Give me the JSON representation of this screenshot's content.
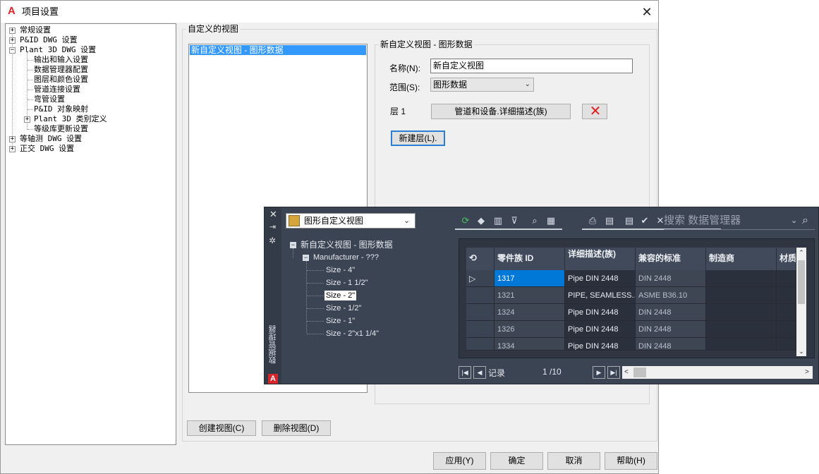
{
  "dialog": {
    "title": "项目设置",
    "app_logo": "A",
    "close_glyph": "✕"
  },
  "left_tree": [
    {
      "label": "常规设置",
      "expander": "+"
    },
    {
      "label": "P&ID DWG 设置",
      "expander": "+"
    },
    {
      "label": "Plant 3D DWG 设置",
      "expander": "−"
    },
    {
      "label": "输出和输入设置"
    },
    {
      "label": "数据管理器配置"
    },
    {
      "label": "图层和颜色设置"
    },
    {
      "label": "管道连接设置"
    },
    {
      "label": "弯管设置"
    },
    {
      "label": "P&ID 对象映射"
    },
    {
      "label": "Plant 3D 类别定义",
      "expander": "+"
    },
    {
      "label": "等级库更新设置"
    },
    {
      "label": "等轴测 DWG 设置",
      "expander": "+"
    },
    {
      "label": "正交 DWG 设置",
      "expander": "+"
    }
  ],
  "custom_views": {
    "legend": "自定义的视图",
    "items": [
      "新自定义视图 - 图形数据"
    ],
    "detail_legend": "新自定义视图 - 图形数据",
    "name_label": "名称(N):",
    "name_value": "新自定义视图",
    "scope_label": "范围(S):",
    "scope_value": "图形数据",
    "layer_label": "层 1",
    "layer_button": "管道和设备.详细描述(族)",
    "new_layer_button": "新建层(L)."
  },
  "buttons": {
    "create_view": "创建视图(C)",
    "delete_view": "删除视图(D)",
    "apply": "应用(Y)",
    "ok": "确定",
    "cancel": "取消",
    "help": "帮助(H)"
  },
  "data_manager": {
    "side_title": "数据管理器",
    "view_select": "图形自定义视图",
    "search_placeholder": "搜索 数据管理器",
    "toolbar_icons": [
      "refresh-icon",
      "cubes-icon",
      "columns-icon",
      "filter-clear-icon",
      "zoom-icon",
      "grid-select-icon",
      "print-icon",
      "export-icon",
      "import-icon",
      "accept-icon",
      "reject-icon"
    ],
    "tree": {
      "root": "新自定义视图 - 图形数据",
      "child": "Manufacturer - ???",
      "leaves": [
        "Size - 4\"",
        "Size - 1 1/2\"",
        "Size - 2\"",
        "Size - 1/2\"",
        "Size - 1\"",
        "Size - 2\"x1 1/4\""
      ],
      "selected_index": 2
    },
    "grid": {
      "headers": [
        "零件族 ID",
        "详细描述(族)",
        "兼容的标准",
        "制造商",
        "材质"
      ],
      "rows": [
        [
          "1317",
          "Pipe DIN 2448",
          "DIN 2448",
          "",
          ""
        ],
        [
          "1321",
          "PIPE, SEAMLESS...",
          "ASME B36.10",
          "",
          ""
        ],
        [
          "1324",
          "Pipe DIN 2448",
          "DIN 2448",
          "",
          ""
        ],
        [
          "1326",
          "Pipe DIN 2448",
          "DIN 2448",
          "",
          ""
        ],
        [
          "1334",
          "Pipe DIN 2448",
          "DIN 2448",
          "",
          ""
        ]
      ],
      "record_label": "记录",
      "record_count": "1 /10"
    }
  }
}
